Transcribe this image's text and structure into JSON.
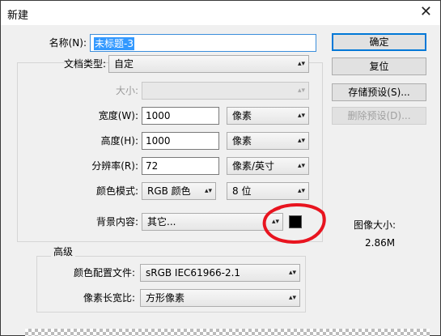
{
  "window": {
    "title": "新建"
  },
  "name": {
    "label": "名称(N):",
    "value": "未标题-3"
  },
  "preset": {
    "label": "文档类型:",
    "value": "自定"
  },
  "size": {
    "label": "大小:",
    "value": ""
  },
  "width": {
    "label": "宽度(W):",
    "value": "1000",
    "unit": "像素"
  },
  "height": {
    "label": "高度(H):",
    "value": "1000",
    "unit": "像素"
  },
  "resolution": {
    "label": "分辨率(R):",
    "value": "72",
    "unit": "像素/英寸"
  },
  "color_mode": {
    "label": "颜色模式:",
    "mode": "RGB 颜色",
    "depth": "8 位"
  },
  "background": {
    "label": "背景内容:",
    "value": "其它...",
    "swatch_color": "#000000"
  },
  "advanced": {
    "title": "高级",
    "profile_label": "颜色配置文件:",
    "profile_value": "sRGB IEC61966-2.1",
    "aspect_label": "像素长宽比:",
    "aspect_value": "方形像素"
  },
  "buttons": {
    "ok": "确定",
    "reset": "复位",
    "save_preset": "存储预设(S)...",
    "delete_preset": "删除预设(D)..."
  },
  "image_size": {
    "label": "图像大小:",
    "value": "2.86M"
  },
  "annotation_color": "#e8141f"
}
